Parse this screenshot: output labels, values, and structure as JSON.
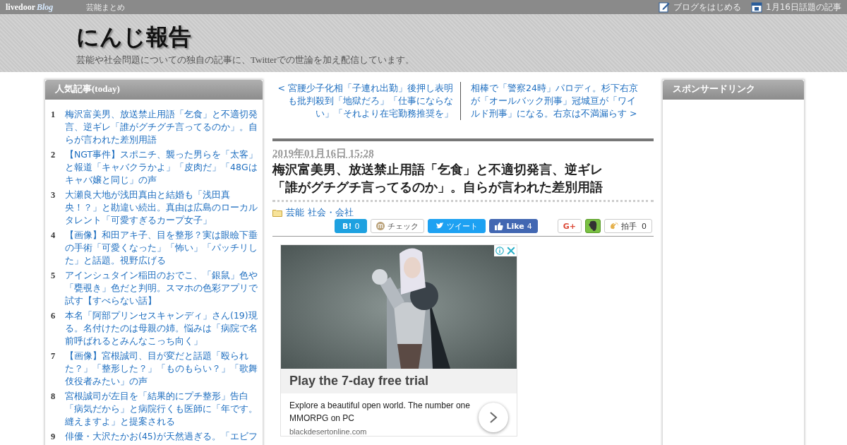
{
  "topbar": {
    "logo_text": "livedoor",
    "logo_blog": "Blog",
    "link": "芸能まとめ",
    "right_links": [
      {
        "kind": "pen",
        "label": "ブログをはじめる"
      },
      {
        "kind": "calendar",
        "label": "1月16日話題の記事"
      }
    ]
  },
  "header": {
    "title": "にんじ報告",
    "description": "芸能や社会問題についての独自の記事に、Twitterでの世論を加え配信しています。"
  },
  "popular": {
    "title": "人気記事(today)",
    "items": [
      {
        "rank": "1",
        "title": "梅沢富美男、放送禁止用語「乞食」と不適切発言、逆ギレ「誰がグチグチ言ってるのか」。自らが言われた差別用語"
      },
      {
        "rank": "2",
        "title": "【NGT事件】スポニチ、襲った男らを「太客」と報道「キャバクラかよ」「皮肉だ」「48Gはキャバ嬢と同じ」の声"
      },
      {
        "rank": "3",
        "title": "大瀬良大地が浅田真由と結婚も「浅田真央！？」と勘違い続出。真由は広島のローカルタレント「可愛すぎるカープ女子」"
      },
      {
        "rank": "4",
        "title": "【画像】和田アキ子、目を整形？実は眼瞼下垂の手術「可愛くなった」「怖い」「パッチリした」と話題。視野広げる"
      },
      {
        "rank": "5",
        "title": "アインシュタイン稲田のおでこ、「銀鼠」色や「甕覗き」色だと判明。スマホの色彩アプリで試す【すべらない話】"
      },
      {
        "rank": "6",
        "title": "本名「阿部プリンセスキャンディ」さん(19)現る。名付けたのは母親の姉。悩みは「病院で名前呼ばれるとみんなこっち向く」"
      },
      {
        "rank": "7",
        "title": "【画像】宮根誠司、目が変だと話題「殴られた？」「整形した？」「ものもらい？」「歌舞伎役者みたい」の声"
      },
      {
        "rank": "8",
        "title": "宮根誠司が左目を「結果的にプチ整形」告白「病気だから」と病院行くも医師に「年です。縫えますよ」と提案される"
      },
      {
        "rank": "9",
        "title": "俳優・大沢たかお(45)が天然過ぎる。「エビフ"
      }
    ]
  },
  "nav": {
    "prev": "< 宮腰少子化相「子連れ出勤」後押し表明も批判殺到「地獄だろ」「仕事にならない」「それより在宅勤務推奨を」",
    "next": "相棒で「警察24時」パロディ。杉下右京が「オールバック刑事」冠城亘が「ワイルド刑事」になる。右京は不満漏らす >"
  },
  "article": {
    "date": "2019年01月16日 15:28",
    "title": "梅沢富美男、放送禁止用語「乞食」と不適切発言、逆ギレ「誰がグチグチ言ってるのか」。自らが言われた差別用語",
    "categories": [
      "芸能",
      "社会・会社"
    ]
  },
  "share_buttons": [
    {
      "kind": "hatena",
      "label": "B!",
      "count": "0"
    },
    {
      "kind": "mixi",
      "label": "チェック"
    },
    {
      "kind": "tweet",
      "label": "ツイート"
    },
    {
      "kind": "like",
      "label": "Like",
      "count": "4"
    },
    {
      "kind": "gplus",
      "label": "G+"
    },
    {
      "kind": "evernote"
    },
    {
      "kind": "clap",
      "label": "拍手",
      "count": "0"
    }
  ],
  "ad": {
    "headline": "Play the 7-day free trial",
    "body": "Explore a beautiful open world. The number one MMORPG on PC",
    "domain": "blackdesertonline.com"
  },
  "sponsor": {
    "title": "スポンサードリンク"
  }
}
